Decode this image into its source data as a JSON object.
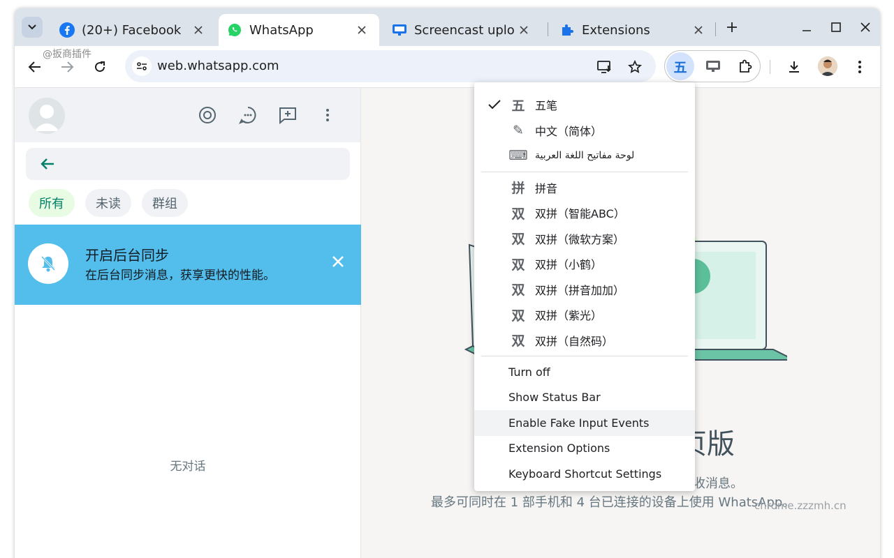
{
  "tabs": [
    {
      "title": "(20+) Facebook",
      "icon": "facebook-icon"
    },
    {
      "title": "WhatsApp",
      "icon": "whatsapp-icon",
      "active": true
    },
    {
      "title": "Screencast uplo",
      "icon": "screencast-icon"
    },
    {
      "title": "Extensions",
      "icon": "puzzle-icon"
    }
  ],
  "toolbar": {
    "watermark": "@扳商插件",
    "url": "web.whatsapp.com",
    "ime_badge": "五"
  },
  "whatsapp": {
    "filters": [
      "所有",
      "未读",
      "群组"
    ],
    "banner_title": "开启后台同步",
    "banner_sub": "在后台同步消息，获享更快的性能。",
    "empty_text": "无对话",
    "hero_title": "页版",
    "hero_line1": "收消息。",
    "hero_line2": "最多可同时在 1 部手机和 4 台已连接的设备上使用 WhatsApp。",
    "site_mark": "chrome.zzzmh.cn"
  },
  "menu": {
    "ime_items": [
      {
        "icon_text": "五",
        "label": "五笔",
        "checked": true
      },
      {
        "icon_text": "✎",
        "label": "中文（简体）"
      },
      {
        "icon_text": "⌨",
        "label": "لوحة مفاتيح اللغة العربية"
      }
    ],
    "pinyin_items": [
      {
        "icon_text": "拼",
        "label": "拼音"
      },
      {
        "icon_text": "双",
        "label": "双拼（智能ABC）"
      },
      {
        "icon_text": "双",
        "label": "双拼（微软方案）"
      },
      {
        "icon_text": "双",
        "label": "双拼（小鹤）"
      },
      {
        "icon_text": "双",
        "label": "双拼（拼音加加）"
      },
      {
        "icon_text": "双",
        "label": "双拼（紫光）"
      },
      {
        "icon_text": "双",
        "label": "双拼（自然码）"
      }
    ],
    "actions": [
      "Turn off",
      "Show Status Bar",
      "Enable Fake Input Events",
      "Extension Options",
      "Keyboard Shortcut Settings"
    ]
  },
  "colors": {
    "chrome_frame": "#dde3ea",
    "banner": "#53bdeb",
    "whatsapp_green": "#008069",
    "ime_accent": "#1a6fd8"
  }
}
